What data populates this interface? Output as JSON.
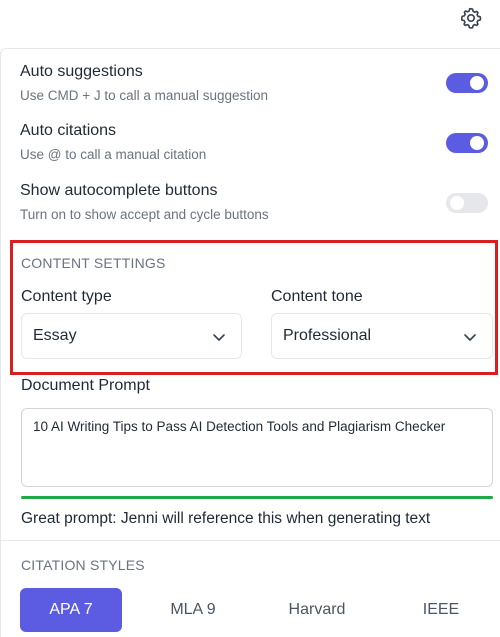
{
  "header": {
    "settings_icon": "gear-icon"
  },
  "toggles": [
    {
      "title": "Auto suggestions",
      "description": "Use CMD + J to call a manual suggestion",
      "state": "on"
    },
    {
      "title": "Auto citations",
      "description": "Use @ to call a manual citation",
      "state": "on"
    },
    {
      "title": "Show autocomplete buttons",
      "description": "Turn on to show accept and cycle buttons",
      "state": "off"
    }
  ],
  "content_settings": {
    "heading": "CONTENT SETTINGS",
    "type_label": "Content type",
    "type_value": "Essay",
    "tone_label": "Content tone",
    "tone_value": "Professional"
  },
  "document_prompt": {
    "label": "Document Prompt",
    "value": "10 AI Writing Tips to Pass AI Detection Tools and Plagiarism Checker",
    "hint": "Great prompt: Jenni will reference this when generating text"
  },
  "citation_styles": {
    "heading": "CITATION STYLES",
    "options": [
      "APA 7",
      "MLA 9",
      "Harvard",
      "IEEE"
    ],
    "selected": "APA 7"
  },
  "colors": {
    "accent": "#5b5ce2",
    "highlight_border": "#d61f1f",
    "prompt_quality": "#22a847"
  }
}
